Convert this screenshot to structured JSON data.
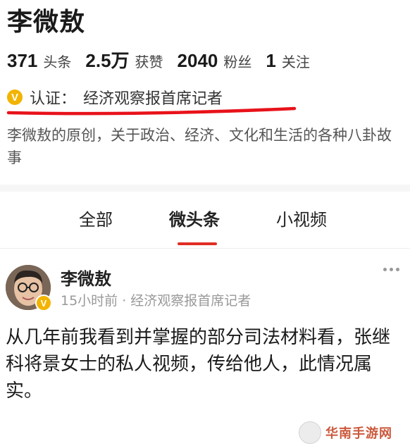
{
  "profile": {
    "name": "李微敖",
    "stats": [
      {
        "num": "371",
        "label": "头条"
      },
      {
        "num": "2.5万",
        "label": "获赞"
      },
      {
        "num": "2040",
        "label": "粉丝"
      },
      {
        "num": "1",
        "label": "关注"
      }
    ],
    "verify_badge": "V",
    "verify_label": "认证：",
    "verify_title": "经济观察报首席记者",
    "bio": "李微敖的原创，关于政治、经济、文化和生活的各种八卦故事"
  },
  "tabs": [
    "全部",
    "微头条",
    "小视频"
  ],
  "active_tab": "微头条",
  "post": {
    "author": "李微敖",
    "meta": "15小时前 · 经济观察报首席记者",
    "body": "从几年前我看到并掌握的部分司法材料看，张继科将景女士的私人视频，传给他人，此情况属实。"
  },
  "watermark": {
    "text": "华南手游网"
  },
  "colors": {
    "accent_red": "#e02e24",
    "verify_gold": "#f2b400",
    "annotation_red": "#e8121a"
  },
  "icons": {
    "more": "more-dots-icon",
    "verify": "verified-badge-icon"
  }
}
